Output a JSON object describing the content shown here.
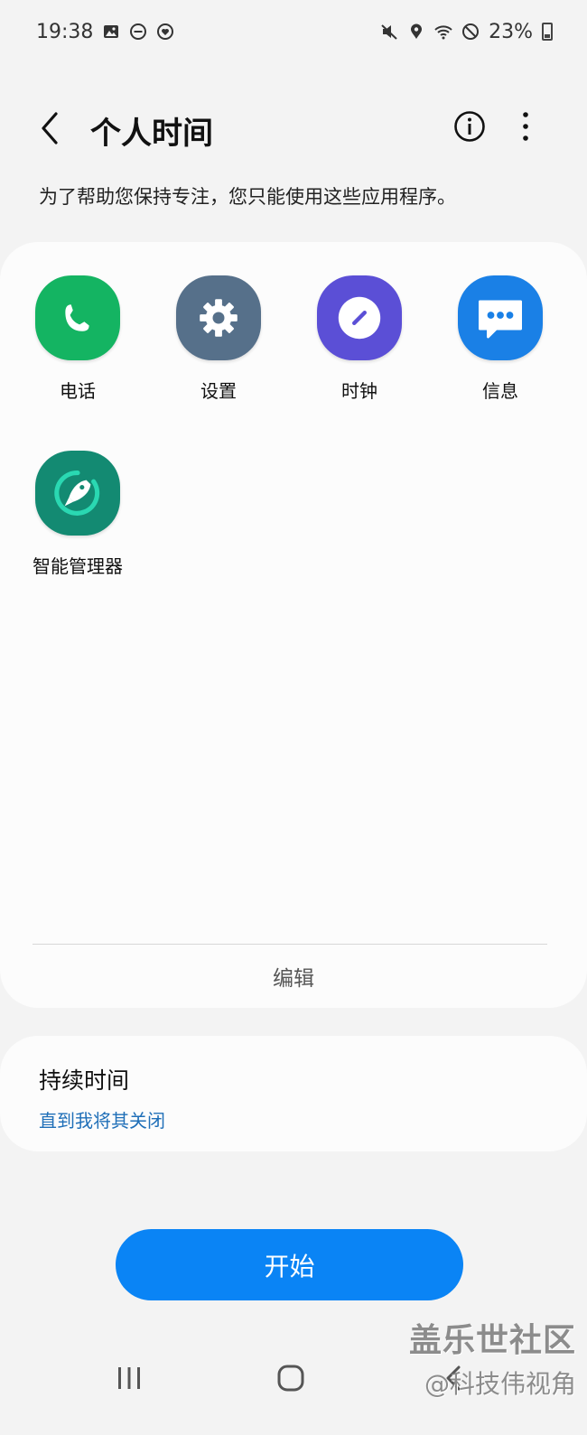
{
  "status_bar": {
    "time": "19:38",
    "battery": "23%",
    "left_icons": [
      "gallery-icon",
      "dnd-icon",
      "heart-badge-icon"
    ],
    "right_icons": [
      "mute-icon",
      "location-icon",
      "wifi-icon",
      "block-icon",
      "battery-icon"
    ]
  },
  "header": {
    "title": "个人时间",
    "subtitle": "为了帮助您保持专注，您只能使用这些应用程序。"
  },
  "apps": [
    {
      "label": "电话",
      "icon": "phone-icon",
      "color": "#14b462"
    },
    {
      "label": "设置",
      "icon": "gear-icon",
      "color": "#56708a"
    },
    {
      "label": "时钟",
      "icon": "clock-icon",
      "color": "#5b4fd6"
    },
    {
      "label": "信息",
      "icon": "message-icon",
      "color": "#1a80e6"
    },
    {
      "label": "智能管理器",
      "icon": "rocket-icon",
      "color": "#138a72"
    }
  ],
  "edit_label": "编辑",
  "duration": {
    "title": "持续时间",
    "value": "直到我将其关闭"
  },
  "start_label": "开始",
  "watermark": {
    "line1": "盖乐世社区",
    "line2": "@科技伟视角"
  },
  "colors": {
    "accent": "#0a84f5",
    "link": "#1f6fb8",
    "background": "#f3f3f3",
    "card": "#fcfcfc"
  }
}
